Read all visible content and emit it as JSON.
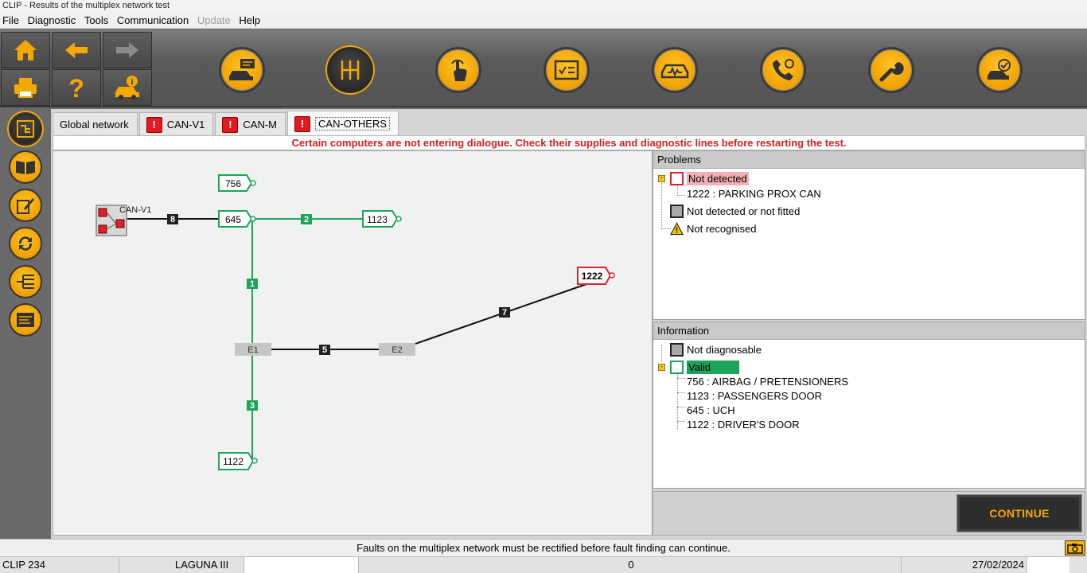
{
  "window": {
    "title": "CLIP - Results of the multiplex network test"
  },
  "menu": [
    {
      "label": "File",
      "enabled": true
    },
    {
      "label": "Diagnostic",
      "enabled": true
    },
    {
      "label": "Tools",
      "enabled": true
    },
    {
      "label": "Communication",
      "enabled": true
    },
    {
      "label": "Update",
      "enabled": false
    },
    {
      "label": "Help",
      "enabled": true
    }
  ],
  "toolbar": {
    "left_buttons": [
      "home-icon",
      "back-arrow-icon",
      "forward-arrow-icon",
      "print-icon",
      "help-icon",
      "vehicle-info-icon"
    ],
    "main_buttons": [
      "vehicle-identification-icon",
      "multiplex-network-icon",
      "touch-test-icon",
      "checklist-icon",
      "vehicle-diagnostic-icon",
      "phone-support-icon",
      "wrench-icon",
      "vehicle-validated-icon"
    ]
  },
  "sidebar": [
    "network-map-icon",
    "manual-book-icon",
    "edit-network-icon",
    "refresh-network-icon",
    "bus-lines-icon",
    "summary-icon"
  ],
  "tabs": [
    {
      "label": "Global network",
      "warning": false,
      "active": false
    },
    {
      "label": "CAN-V1",
      "warning": true,
      "active": false
    },
    {
      "label": "CAN-M",
      "warning": true,
      "active": false
    },
    {
      "label": "CAN-OTHERS",
      "warning": true,
      "active": true
    }
  ],
  "message": "Certain computers are not entering dialogue. Check their supplies and diagnostic lines before restarting the test.",
  "diagram": {
    "bus_label": "CAN-V1",
    "nodes": {
      "n756": "756",
      "n645": "645",
      "n1123": "1123",
      "n1222": "1222",
      "n1122": "1122"
    },
    "junctions": {
      "e1": "E1",
      "e2": "E2"
    },
    "links": {
      "l1": "1",
      "l2": "2",
      "l3": "3",
      "l5": "5",
      "l7": "7",
      "l8": "8"
    }
  },
  "problems": {
    "header": "Problems",
    "not_detected": "Not detected",
    "not_detected_items": [
      "1222 : PARKING PROX CAN"
    ],
    "not_fitted": "Not detected or not fitted",
    "not_recognised": "Not recognised"
  },
  "information": {
    "header": "Information",
    "not_diagnosable": "Not diagnosable",
    "valid": "Valid",
    "valid_items": [
      "756 : AIRBAG / PRETENSIONERS",
      "1123 : PASSENGERS DOOR",
      "645 : UCH",
      "1122 : DRIVER'S DOOR"
    ]
  },
  "continue_label": "CONTINUE",
  "status_message": "Faults on the multiplex network must be rectified before fault finding can continue.",
  "bottom": {
    "version": "CLIP 234",
    "vehicle": "LAGUNA III",
    "counter": "0",
    "date": "27/02/2024"
  },
  "colors": {
    "accent": "#f5a800",
    "valid": "#1ca55a",
    "error": "#e0202a",
    "warning_text": "#d42020"
  }
}
